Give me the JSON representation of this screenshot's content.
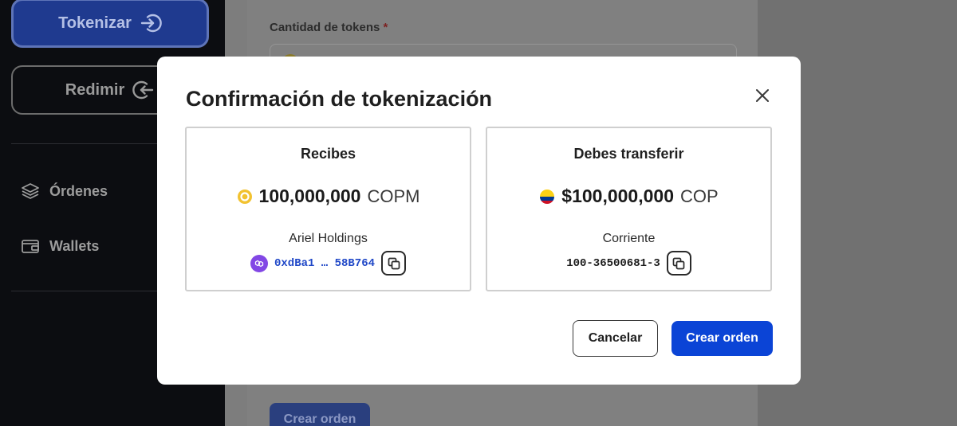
{
  "sidebar": {
    "tokenize_label": "Tokenizar",
    "redeem_label": "Redimir",
    "nav": [
      {
        "label": "Órdenes",
        "icon": "layers-icon"
      },
      {
        "label": "Wallets",
        "icon": "wallet-icon"
      }
    ]
  },
  "form": {
    "token_amount_label": "Cantidad de tokens",
    "required_mark": "*",
    "create_order_label": "Crear orden"
  },
  "modal": {
    "title": "Confirmación de tokenización",
    "receive": {
      "heading": "Recibes",
      "amount": "100,000,000",
      "unit": "COPM",
      "holder": "Ariel Holdings",
      "address": "0xdBa1 … 58B764"
    },
    "transfer": {
      "heading": "Debes transferir",
      "amount": "$100,000,000",
      "unit": "COP",
      "account_type": "Corriente",
      "account_number": "100-36500681-3"
    },
    "cancel_label": "Cancelar",
    "create_label": "Crear orden"
  },
  "colors": {
    "primary": "#0b44d6",
    "address_text": "#1f47c7",
    "copm_coin": "#f2c230",
    "polygon": "#8247e5"
  }
}
